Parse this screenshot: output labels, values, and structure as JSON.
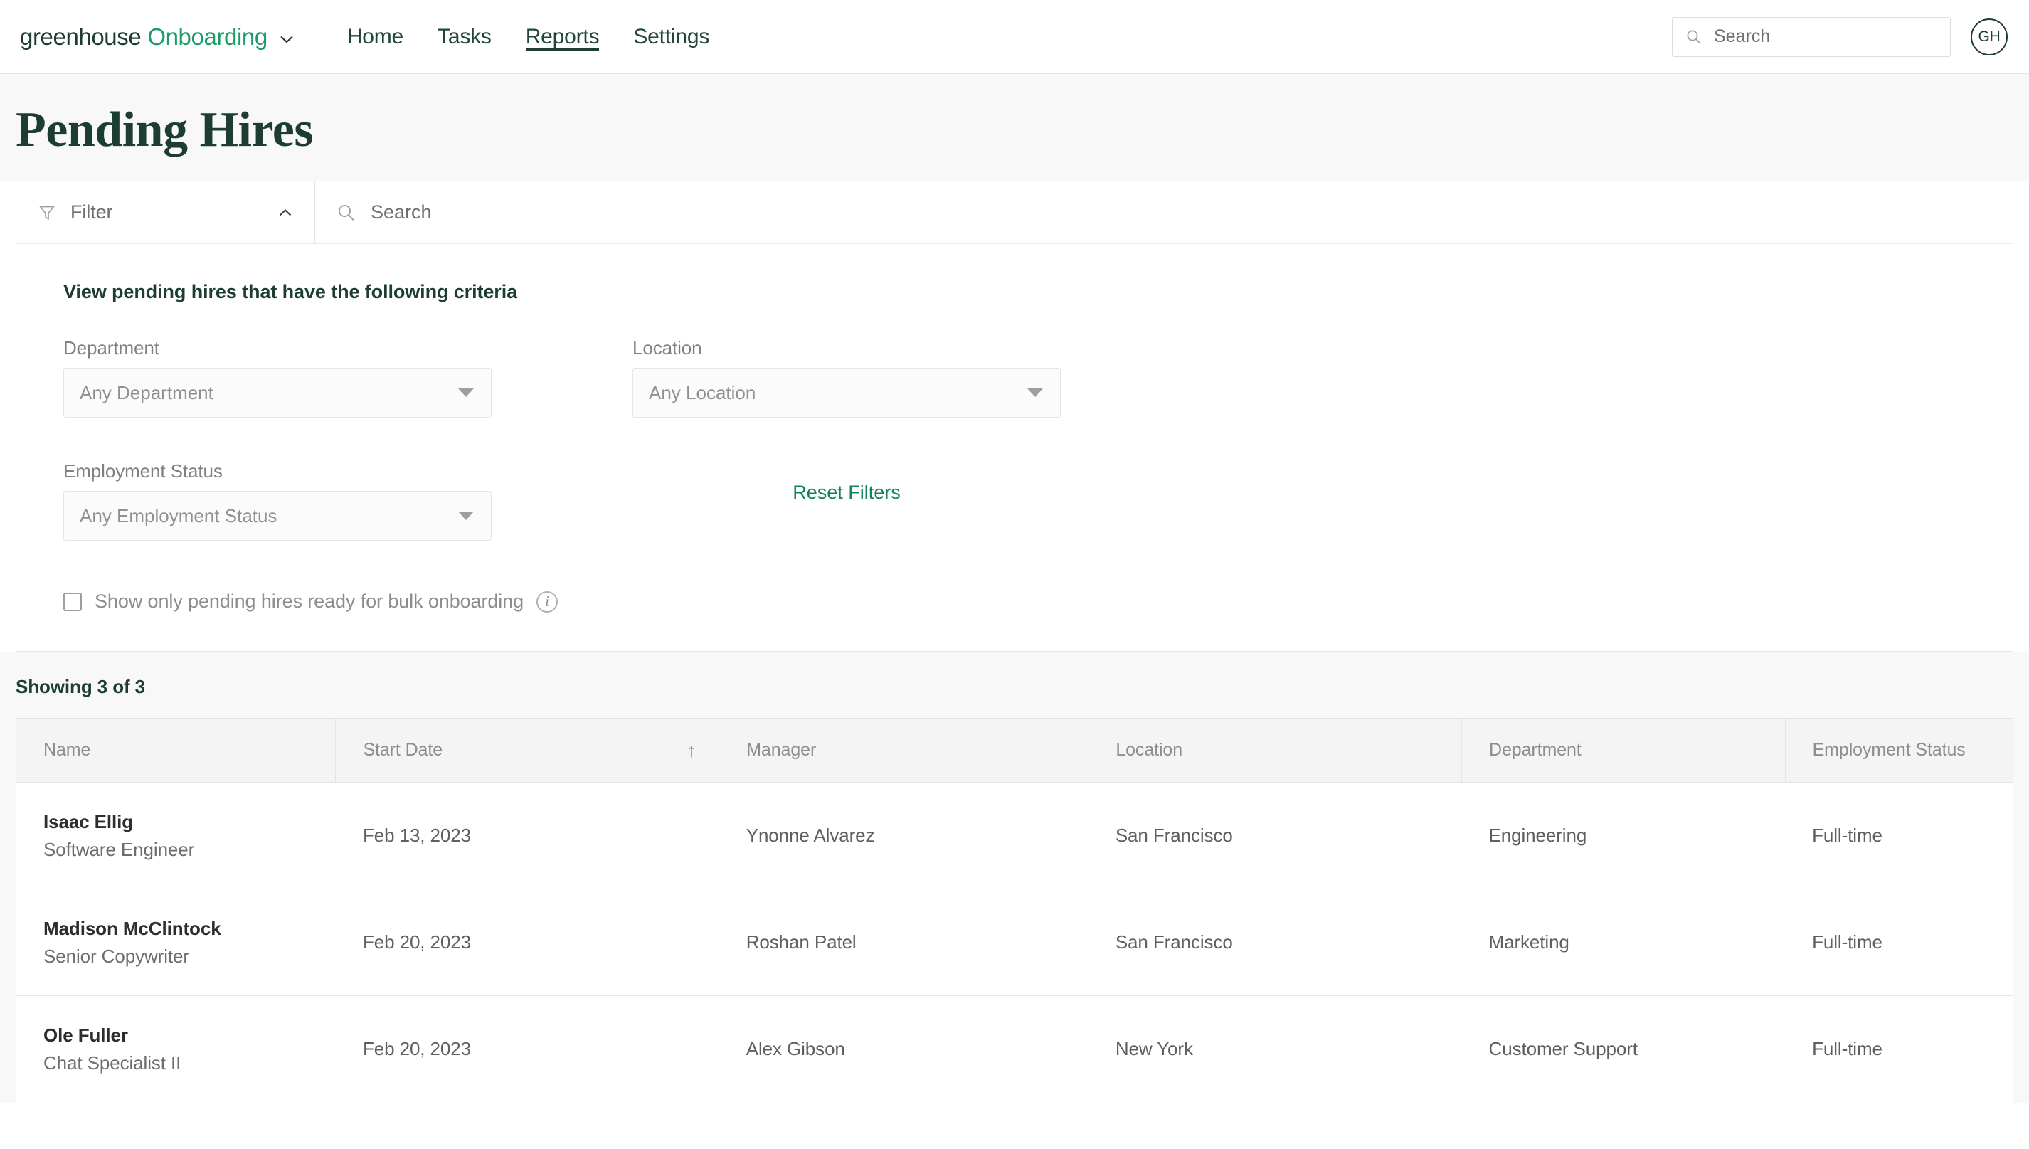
{
  "brand": {
    "primary": "greenhouse",
    "accent": "Onboarding",
    "accent_color": "#1a9c6a",
    "chevron_icon": "chevron-down-icon"
  },
  "nav": {
    "links": [
      {
        "label": "Home",
        "active": false
      },
      {
        "label": "Tasks",
        "active": false
      },
      {
        "label": "Reports",
        "active": true
      },
      {
        "label": "Settings",
        "active": false
      }
    ],
    "search": {
      "placeholder": "Search",
      "value": "",
      "icon": "search-icon"
    },
    "avatar": {
      "initials": "GH"
    }
  },
  "page": {
    "title": "Pending Hires"
  },
  "filter": {
    "toggle_label": "Filter",
    "funnel_icon": "filter-funnel-icon",
    "chevron_icon": "chevron-up-icon",
    "expanded": true,
    "search": {
      "placeholder": "Search",
      "value": "",
      "icon": "search-icon"
    },
    "criteria_title": "View pending hires that have the following criteria",
    "fields": [
      {
        "label": "Department",
        "value": "Any Department"
      },
      {
        "label": "Location",
        "value": "Any Location"
      },
      {
        "label": "Employment Status",
        "value": "Any Employment Status"
      }
    ],
    "reset_label": "Reset Filters",
    "reset_color": "#11845c",
    "bulk_checkbox": {
      "label": "Show only pending hires ready for bulk onboarding",
      "checked": false,
      "info_icon": "info-circle-icon",
      "info_glyph": "i"
    }
  },
  "results": {
    "showing": "Showing 3 of 3",
    "columns": [
      {
        "label": "Name",
        "sort": ""
      },
      {
        "label": "Start Date",
        "sort": "↑"
      },
      {
        "label": "Manager",
        "sort": ""
      },
      {
        "label": "Location",
        "sort": ""
      },
      {
        "label": "Department",
        "sort": ""
      },
      {
        "label": "Employment Status",
        "sort": ""
      }
    ],
    "rows": [
      {
        "name": "Isaac Ellig",
        "role": "Software Engineer",
        "start_date": "Feb 13, 2023",
        "manager": "Ynonne Alvarez",
        "location": "San Francisco",
        "department": "Engineering",
        "employment_status": "Full-time"
      },
      {
        "name": "Madison McClintock",
        "role": "Senior Copywriter",
        "start_date": "Feb 20, 2023",
        "manager": "Roshan Patel",
        "location": "San Francisco",
        "department": "Marketing",
        "employment_status": "Full-time"
      },
      {
        "name": "Ole Fuller",
        "role": "Chat Specialist II",
        "start_date": "Feb 20, 2023",
        "manager": "Alex Gibson",
        "location": "New York",
        "department": "Customer Support",
        "employment_status": "Full-time"
      }
    ]
  }
}
